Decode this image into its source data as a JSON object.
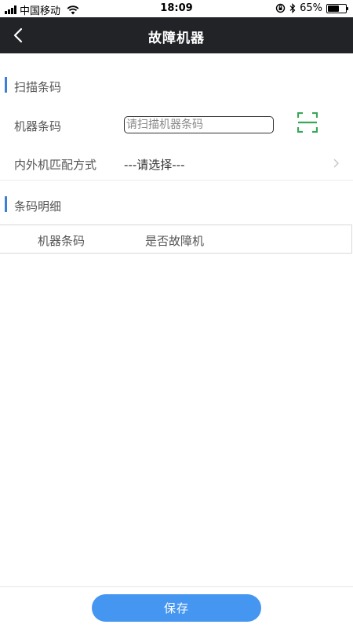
{
  "status_bar": {
    "carrier": "中国移动",
    "time": "18:09",
    "battery_percent": "65%",
    "battery_level": 0.65,
    "icons": [
      "signal-icon",
      "wifi-icon",
      "orientation-lock-icon",
      "bluetooth-icon",
      "battery-icon"
    ]
  },
  "nav": {
    "title": "故障机器",
    "back_icon": "chevron-left-icon"
  },
  "scan_section": {
    "title": "扫描条码",
    "barcode_label": "机器条码",
    "barcode_placeholder": "请扫描机器条码",
    "barcode_value": "",
    "scan_icon": "scan-frame-icon",
    "match_label": "内外机匹配方式",
    "match_value": "---请选择---"
  },
  "detail_section": {
    "title": "条码明细",
    "columns": [
      "机器条码",
      "是否故障机"
    ],
    "rows": []
  },
  "footer": {
    "save_label": "保存"
  },
  "colors": {
    "nav_background": "#222327",
    "accent": "#3b7fd6",
    "button": "#4596f0",
    "scan_icon": "#3aa657"
  }
}
